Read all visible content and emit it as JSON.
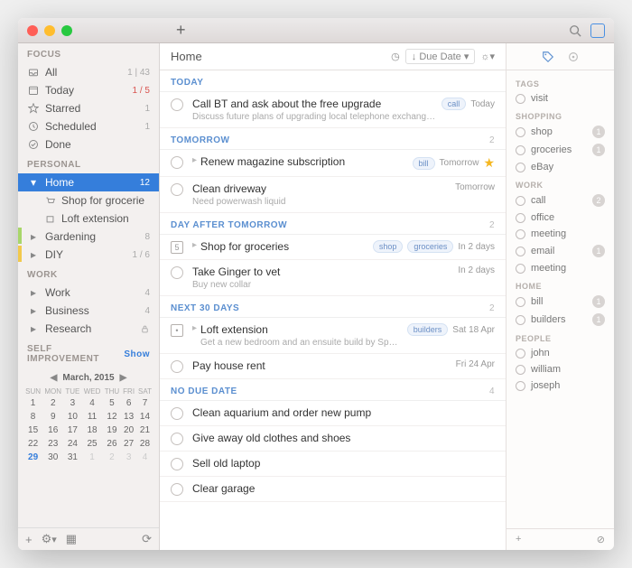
{
  "sidebar": {
    "focus_label": "FOCUS",
    "focus": [
      {
        "icon": "tray",
        "label": "All",
        "count": "43",
        "pre": "1 |"
      },
      {
        "icon": "cal",
        "label": "Today",
        "count": "5",
        "pre": "1 /",
        "red": true
      },
      {
        "icon": "star",
        "label": "Starred",
        "count": "1"
      },
      {
        "icon": "clock",
        "label": "Scheduled",
        "count": "1"
      },
      {
        "icon": "check",
        "label": "Done"
      }
    ],
    "personal_label": "PERSONAL",
    "personal": [
      {
        "label": "Home",
        "count": "12",
        "sel": true,
        "exp": true,
        "children": [
          {
            "icon": "cart",
            "label": "Shop for grocerie"
          },
          {
            "icon": "box",
            "label": "Loft extension"
          }
        ]
      },
      {
        "label": "Gardening",
        "count": "8",
        "dot": "#a8d66a"
      },
      {
        "label": "DIY",
        "count": "6",
        "pre": "1 /",
        "dot": "#f2c94c"
      }
    ],
    "work_label": "WORK",
    "work": [
      {
        "label": "Work",
        "count": "4"
      },
      {
        "label": "Business",
        "count": "4"
      },
      {
        "label": "Research",
        "lock": true
      }
    ],
    "self_label": "SELF IMPROVEMENT",
    "show": "Show"
  },
  "calendar": {
    "title": "March, 2015",
    "days": [
      "SUN",
      "MON",
      "TUE",
      "WED",
      "THU",
      "FRI",
      "SAT"
    ],
    "rows": [
      [
        "1",
        "2",
        "3",
        "4",
        "5",
        "6",
        "7"
      ],
      [
        "8",
        "9",
        "10",
        "11",
        "12",
        "13",
        "14"
      ],
      [
        "15",
        "16",
        "17",
        "18",
        "19",
        "20",
        "21"
      ],
      [
        "22",
        "23",
        "24",
        "25",
        "26",
        "27",
        "28"
      ],
      [
        "29",
        "30",
        "31",
        "1",
        "2",
        "3",
        "4"
      ]
    ],
    "today_row": 4,
    "today_col": 0
  },
  "content": {
    "title": "Home",
    "sort": "Due Date",
    "sections": [
      {
        "title": "TODAY",
        "tasks": [
          {
            "t": "Call BT and ask about the free upgrade",
            "tags": [
              "call"
            ],
            "due": "Today",
            "sub": "Discuss future plans of upgrading local telephone exchange and introducing fibre"
          }
        ]
      },
      {
        "title": "TOMORROW",
        "count": "2",
        "tasks": [
          {
            "t": "Renew magazine subscription",
            "tags": [
              "bill"
            ],
            "due": "Tomorrow",
            "star": true,
            "arrow": true
          },
          {
            "t": "Clean driveway",
            "due": "Tomorrow",
            "sub": "Need powerwash liquid"
          }
        ]
      },
      {
        "title": "DAY AFTER TOMORROW",
        "count": "2",
        "tasks": [
          {
            "t": "Shop for groceries",
            "tags": [
              "shop",
              "groceries"
            ],
            "due": "In 2 days",
            "sq": "5",
            "arrow": true
          },
          {
            "t": "Take Ginger to vet",
            "due": "In 2 days",
            "sub": "Buy new collar"
          }
        ]
      },
      {
        "title": "NEXT 30 DAYS",
        "count": "2",
        "tasks": [
          {
            "t": "Loft extension",
            "tags": [
              "builders"
            ],
            "due": "Sat 18 Apr",
            "sq": "•",
            "arrow": true,
            "sub": "Get a new bedroom and an ensuite build by Spec Builders Inc. Make sure contract covers re..."
          },
          {
            "t": "Pay house rent",
            "due": "Fri 24 Apr"
          }
        ]
      },
      {
        "title": "NO DUE DATE",
        "count": "4",
        "tasks": [
          {
            "t": "Clean aquarium and order new pump"
          },
          {
            "t": "Give away old clothes and shoes"
          },
          {
            "t": "Sell old laptop"
          },
          {
            "t": "Clear garage"
          }
        ]
      }
    ]
  },
  "rbar": {
    "tags_label": "TAGS",
    "tags": [
      {
        "n": "visit"
      }
    ],
    "groups": [
      {
        "h": "SHOPPING",
        "items": [
          {
            "n": "shop",
            "b": "1"
          },
          {
            "n": "groceries",
            "b": "1"
          },
          {
            "n": "eBay"
          }
        ]
      },
      {
        "h": "WORK",
        "items": [
          {
            "n": "call",
            "b": "2"
          },
          {
            "n": "office"
          },
          {
            "n": "meeting"
          },
          {
            "n": "email",
            "b": "1"
          },
          {
            "n": "meeting"
          }
        ]
      },
      {
        "h": "HOME",
        "items": [
          {
            "n": "bill",
            "b": "1"
          },
          {
            "n": "builders",
            "b": "1"
          }
        ]
      },
      {
        "h": "PEOPLE",
        "items": [
          {
            "n": "john"
          },
          {
            "n": "william"
          },
          {
            "n": "joseph"
          }
        ]
      }
    ]
  }
}
